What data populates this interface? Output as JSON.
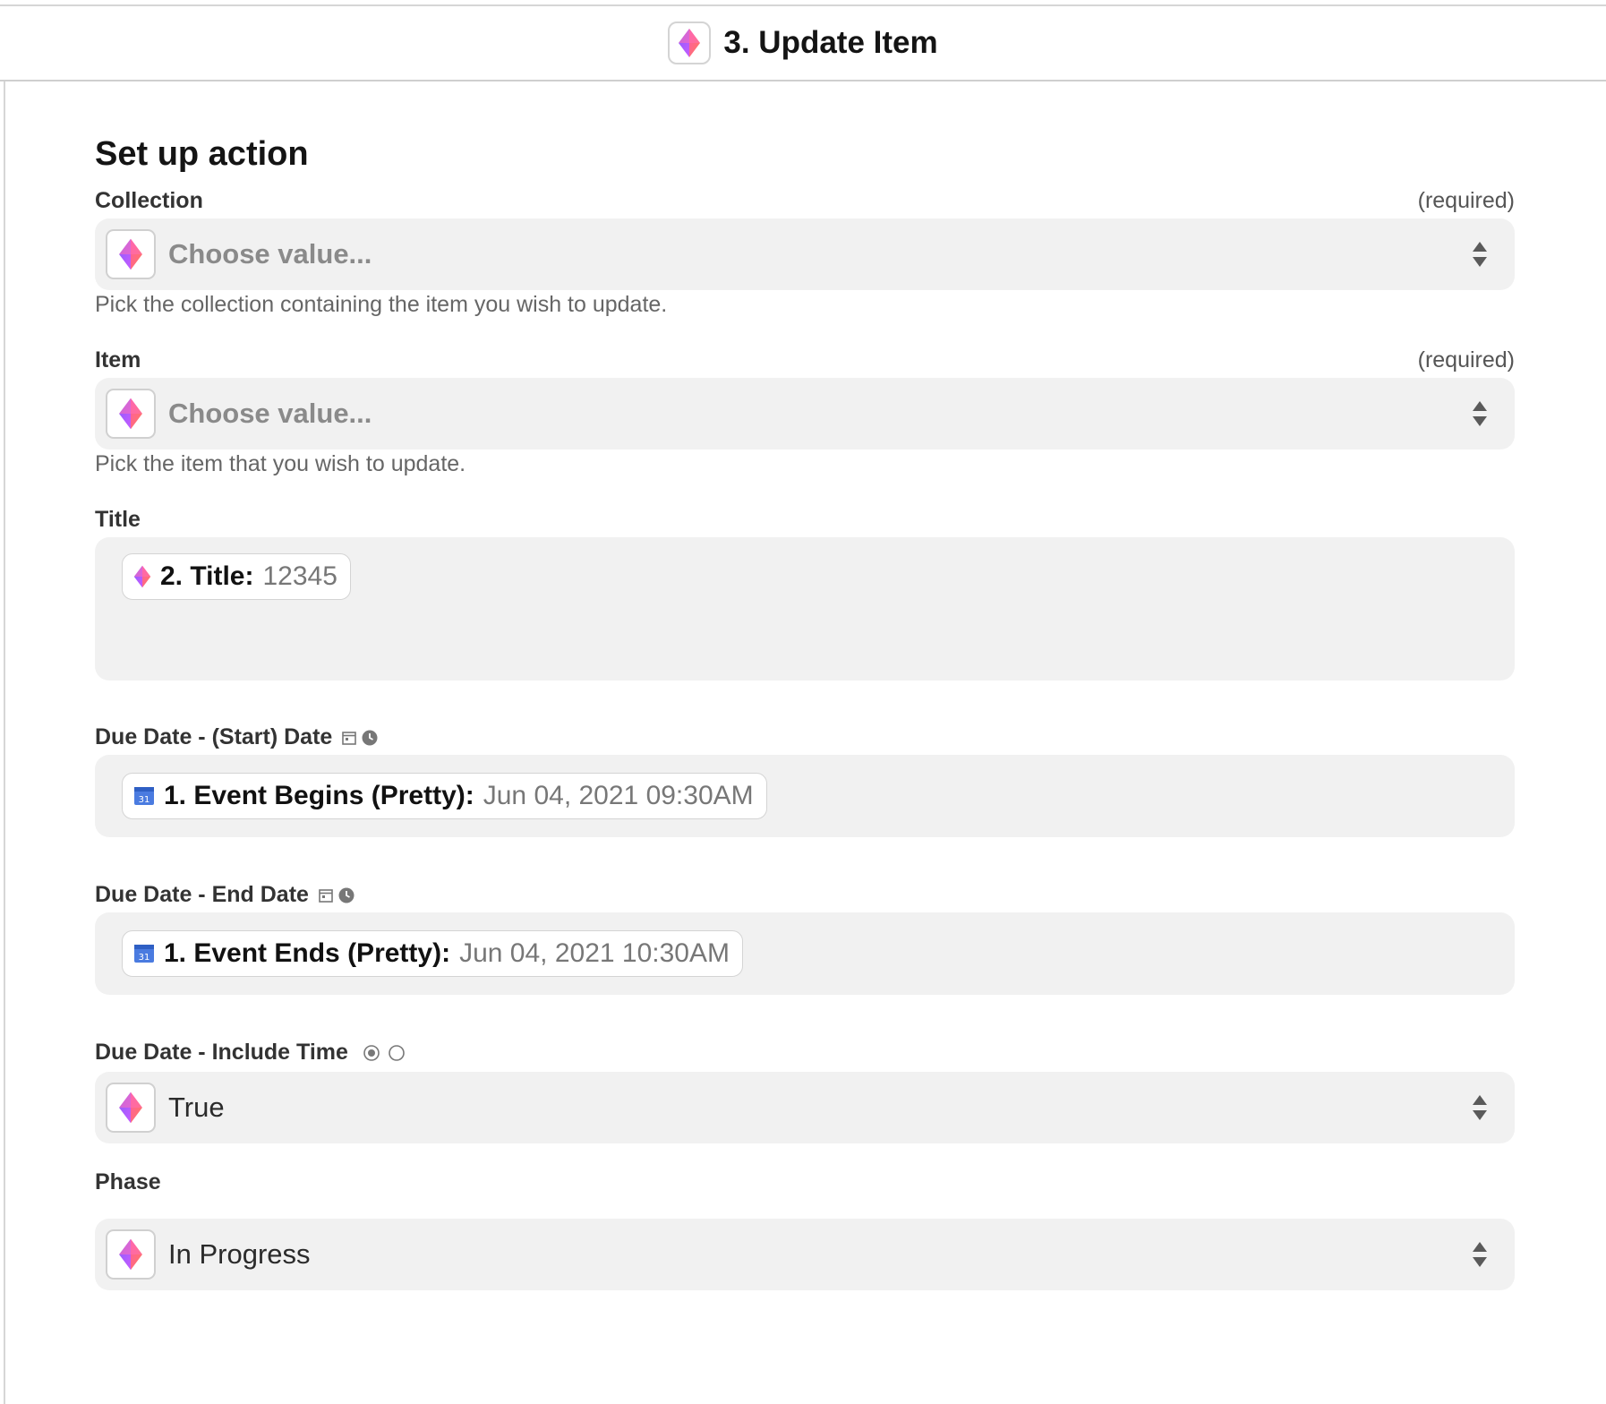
{
  "header": {
    "title": "3. Update Item"
  },
  "section": {
    "title": "Set up action"
  },
  "fields": {
    "collection": {
      "label": "Collection",
      "required": "(required)",
      "placeholder": "Choose value...",
      "help": "Pick the collection containing the item you wish to update."
    },
    "item": {
      "label": "Item",
      "required": "(required)",
      "placeholder": "Choose value...",
      "help": "Pick the item that you wish to update."
    },
    "title": {
      "label": "Title",
      "pill_key": "2. Title:",
      "pill_val": "12345"
    },
    "due_start": {
      "label": "Due Date - (Start) Date",
      "pill_key": "1. Event Begins (Pretty):",
      "pill_val": "Jun 04, 2021 09:30AM"
    },
    "due_end": {
      "label": "Due Date - End Date",
      "pill_key": "1. Event Ends (Pretty):",
      "pill_val": "Jun 04, 2021 10:30AM"
    },
    "include_time": {
      "label": "Due Date - Include Time",
      "value": "True"
    },
    "phase": {
      "label": "Phase",
      "value": "In Progress"
    }
  },
  "icons": {
    "app": "diamond-gradient-icon",
    "calendar": "calendar-31-icon",
    "date_type": "calendar-icon",
    "time_type": "clock-icon",
    "radio_type": "radio-icon",
    "stepper": "up-down-chevron-icon"
  },
  "colors": {
    "field_bg": "#f1f1f1",
    "accent_pink": "#ff4fa0",
    "accent_purple": "#7b5cff",
    "calendar_blue": "#4a7be0"
  }
}
